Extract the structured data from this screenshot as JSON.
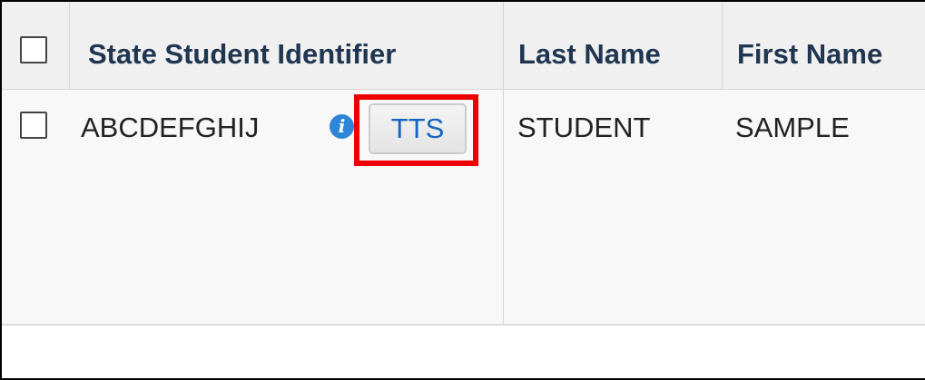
{
  "table": {
    "columns": [
      {
        "label": "State Student Identifier"
      },
      {
        "label": "Last Name"
      },
      {
        "label": "First Name"
      }
    ],
    "rows": [
      {
        "state_student_identifier": "ABCDEFGHIJ",
        "tts_label": "TTS",
        "last_name": "STUDENT",
        "first_name": "SAMPLE",
        "selected": false
      }
    ],
    "select_all_checked": false
  },
  "icons": {
    "info": "info-icon"
  },
  "colors": {
    "header_text": "#1f3550",
    "link_blue": "#1565c0",
    "highlight_red": "#ee0000",
    "info_blue": "#2f86d6"
  }
}
